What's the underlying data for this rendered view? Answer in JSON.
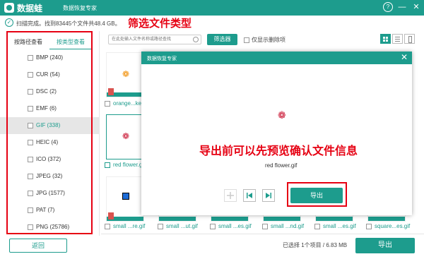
{
  "window": {
    "brand": "数据蛙",
    "subtitle": "数据恢复专家",
    "help_label": "?",
    "minimize_label": "—",
    "close_label": "✕"
  },
  "status": {
    "text": "扫描完成。找到83445个文件共48.4 GB。"
  },
  "annotations": {
    "top": "筛选文件类型",
    "preview": "导出前可以先预览确认文件信息"
  },
  "sidebar": {
    "tabs": [
      {
        "label": "按路径查看"
      },
      {
        "label": "按类型查看"
      }
    ],
    "items": [
      {
        "label": "BMP (240)"
      },
      {
        "label": "CUR (54)"
      },
      {
        "label": "DSC (2)"
      },
      {
        "label": "EMF (6)"
      },
      {
        "label": "GIF (338)"
      },
      {
        "label": "HEIC (4)"
      },
      {
        "label": "ICO (372)"
      },
      {
        "label": "JPEG (32)"
      },
      {
        "label": "JPG (1577)"
      },
      {
        "label": "PAT (7)"
      },
      {
        "label": "PNG (25786)"
      }
    ]
  },
  "toolbar": {
    "search_placeholder": "在此处输入文件名称或路径查找",
    "filter_label": "筛选器",
    "only_deleted_label": "仅显示删除项"
  },
  "grid": {
    "row1_name": "orange...ke.",
    "row2_name": "red flower.g",
    "row3_names": [
      "small ...re.gif",
      "small ...ut.gif",
      "small ...es.gif",
      "small ...nd.gif",
      "small ...es.gif",
      "square...es.gif"
    ]
  },
  "preview": {
    "title": "数据恢复专家",
    "close_label": "✕",
    "file_name": "red flower.gif",
    "export_label": "导出"
  },
  "footer": {
    "back_label": "返回",
    "selection_text": "已选择 1个项目 / 6.83 MB",
    "export_label": "导出"
  },
  "colors": {
    "accent": "#1d9c8d",
    "annotation_red": "#e60012"
  }
}
